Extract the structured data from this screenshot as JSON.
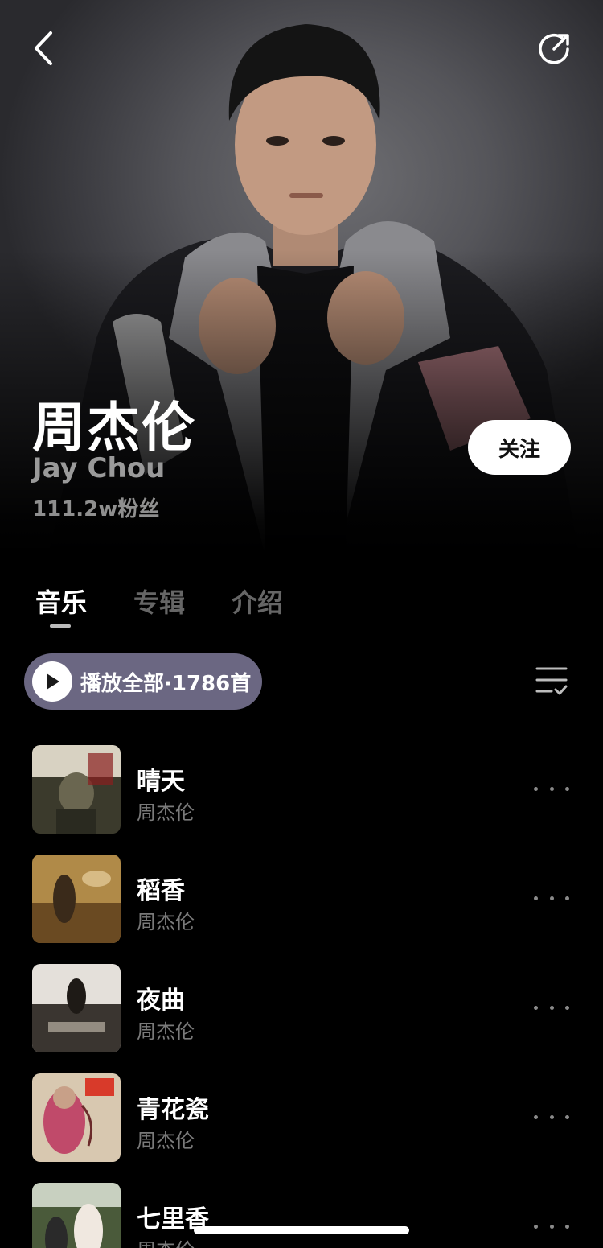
{
  "header": {
    "back_icon": "chevron-left-icon",
    "share_icon": "share-icon"
  },
  "artist": {
    "name": "周杰伦",
    "english_name": "Jay Chou",
    "fans": "111.2w粉丝",
    "follow_label": "关注"
  },
  "tabs": [
    {
      "label": "音乐",
      "active": true
    },
    {
      "label": "专辑",
      "active": false
    },
    {
      "label": "介绍",
      "active": false
    }
  ],
  "play_all": {
    "label": "播放全部·1786首",
    "icon": "play-icon"
  },
  "sort_icon": "list-check-icon",
  "songs": [
    {
      "title": "晴天",
      "artist": "周杰伦"
    },
    {
      "title": "稻香",
      "artist": "周杰伦"
    },
    {
      "title": "夜曲",
      "artist": "周杰伦"
    },
    {
      "title": "青花瓷",
      "artist": "周杰伦"
    },
    {
      "title": "七里香",
      "artist": "周杰伦"
    }
  ],
  "colors": {
    "background": "#000000",
    "play_all_bg": "#6b6782",
    "follow_bg": "#ffffff",
    "secondary_text": "#7a7a7a"
  }
}
